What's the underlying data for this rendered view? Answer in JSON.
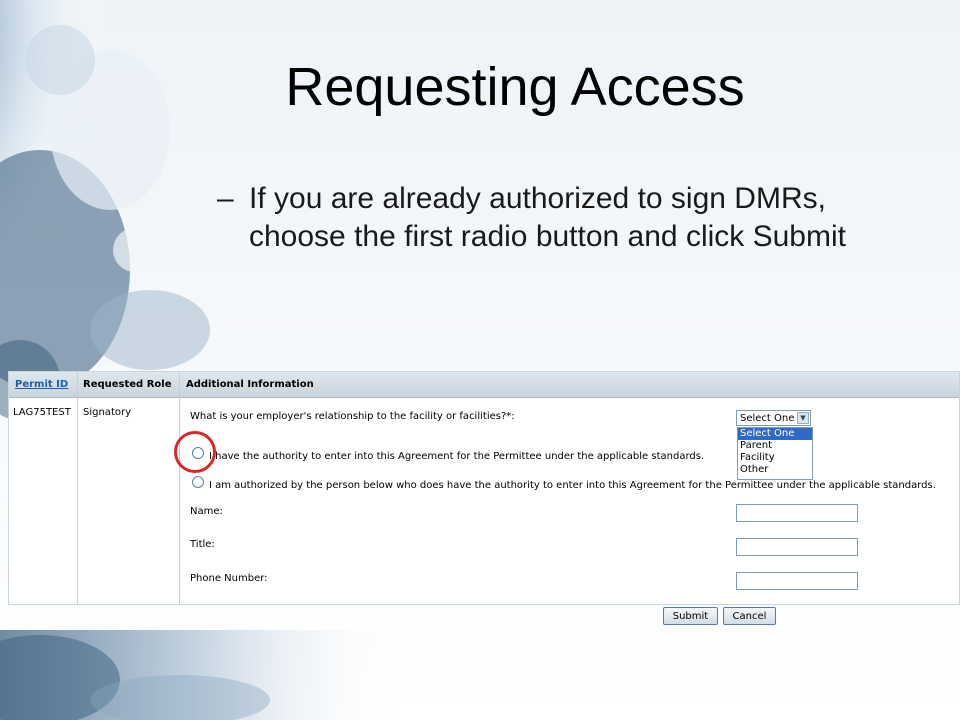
{
  "slide": {
    "title": "Requesting Access",
    "bullet_dash": "–",
    "bullet_text": "If you are already authorized to sign DMRs, choose the first radio button and click Submit"
  },
  "table": {
    "headers": [
      "Permit ID",
      "Requested Role",
      "Additional Information"
    ],
    "permit_id": "LAG75TEST",
    "role": "Signatory",
    "question": "What is your employer's relationship to the facility or facilities?*:",
    "radio_1_label": "I have the authority to enter into this Agreement for the Permittee under the applicable standards.",
    "radio_2_label": "I am authorized by the person below who does have the authority to enter into this Agreement for the Permittee under the applicable standards.",
    "name_label": "Name:",
    "title_label": "Title:",
    "phone_label": "Phone Number:",
    "select_value": "Select One",
    "select_options": [
      "Select One",
      "Parent",
      "Facility",
      "Other"
    ]
  },
  "buttons": {
    "submit": "Submit",
    "cancel": "Cancel"
  },
  "colors": {
    "highlight_circle": "#d42a2a",
    "link": "#1f5fa8"
  }
}
